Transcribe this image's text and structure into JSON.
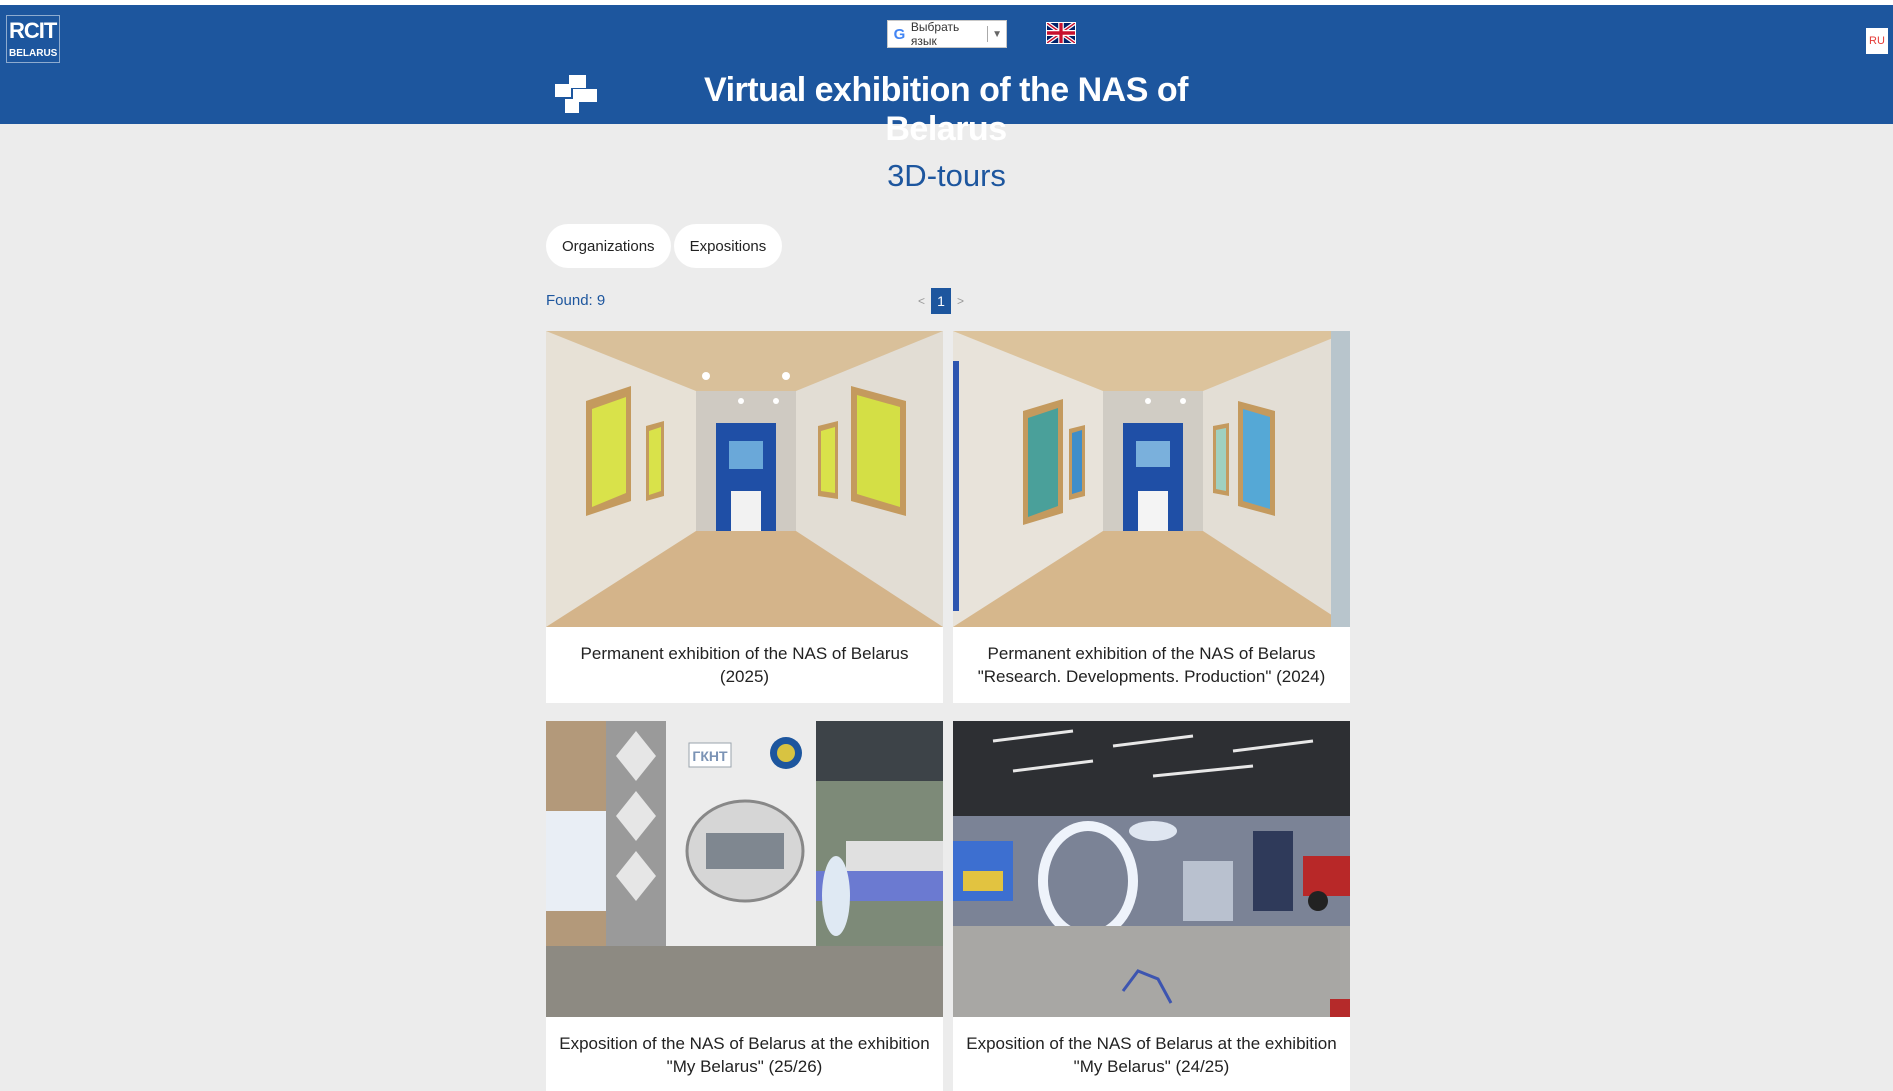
{
  "header": {
    "logo_line1": "RCIT",
    "logo_line2": "BELARUS",
    "language_select": "Выбрать язык",
    "ru_label": "RU",
    "site_title": "Virtual exhibition of the NAS of Belarus",
    "bg_color": "#1d569e"
  },
  "main": {
    "heading": "3D-tours",
    "tabs": [
      {
        "label": "Organizations"
      },
      {
        "label": "Expositions"
      }
    ],
    "found": "Found: 9",
    "pagination": {
      "prev": "<",
      "current": "1",
      "next": ">"
    },
    "cards": [
      {
        "caption": "Permanent exhibition of the NAS of Belarus (2025)"
      },
      {
        "caption": "Permanent exhibition of the NAS of Belarus \"Research. Developments. Production\" (2024)"
      },
      {
        "caption": "Exposition of the NAS of Belarus at the exhibition \"My Belarus\" (25/26)",
        "sign": "ГКНТ"
      },
      {
        "caption": "Exposition of the NAS of Belarus at the exhibition \"My Belarus\" (24/25)"
      }
    ]
  },
  "colors": {
    "accent": "#1d569e",
    "page_bg": "#ececec",
    "ru_text": "#e53935"
  },
  "icons": [
    "google-translate-icon",
    "uk-flag-icon",
    "gallery-icon"
  ]
}
